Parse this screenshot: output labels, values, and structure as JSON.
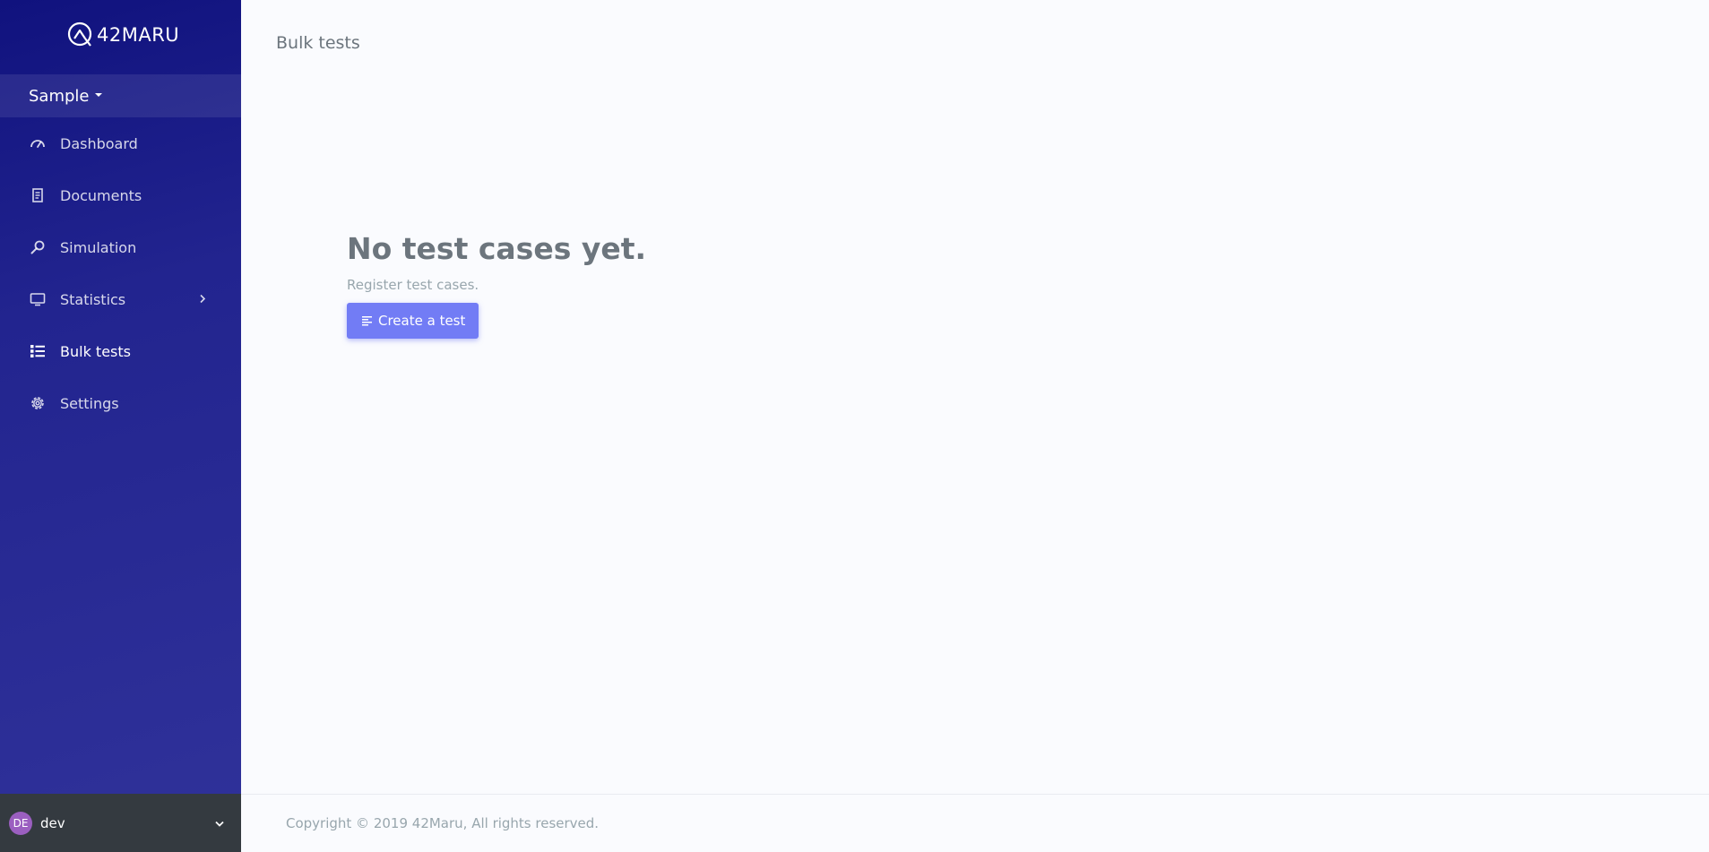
{
  "brand": {
    "name": "42MARU"
  },
  "sidebar": {
    "project": "Sample",
    "items": [
      {
        "label": "Dashboard",
        "icon": "speedometer-icon"
      },
      {
        "label": "Documents",
        "icon": "document-icon"
      },
      {
        "label": "Simulation",
        "icon": "magnifier-icon"
      },
      {
        "label": "Statistics",
        "icon": "monitor-icon"
      },
      {
        "label": "Bulk tests",
        "icon": "list-icon",
        "active": true
      },
      {
        "label": "Settings",
        "icon": "gear-icon"
      }
    ],
    "user": {
      "initials": "DE",
      "name": "dev"
    }
  },
  "main": {
    "page_title": "Bulk tests",
    "empty_title": "No test cases yet.",
    "empty_subtitle": "Register test cases.",
    "create_button": "Create a test"
  },
  "footer": {
    "copyright": "Copyright © 2019 42Maru, All rights reserved."
  },
  "colors": {
    "sidebar_top": "#10127e",
    "sidebar_bottom": "#30329a",
    "accent": "#727cf5",
    "user_bar": "#343a40",
    "avatar": "#9b5fc0"
  }
}
